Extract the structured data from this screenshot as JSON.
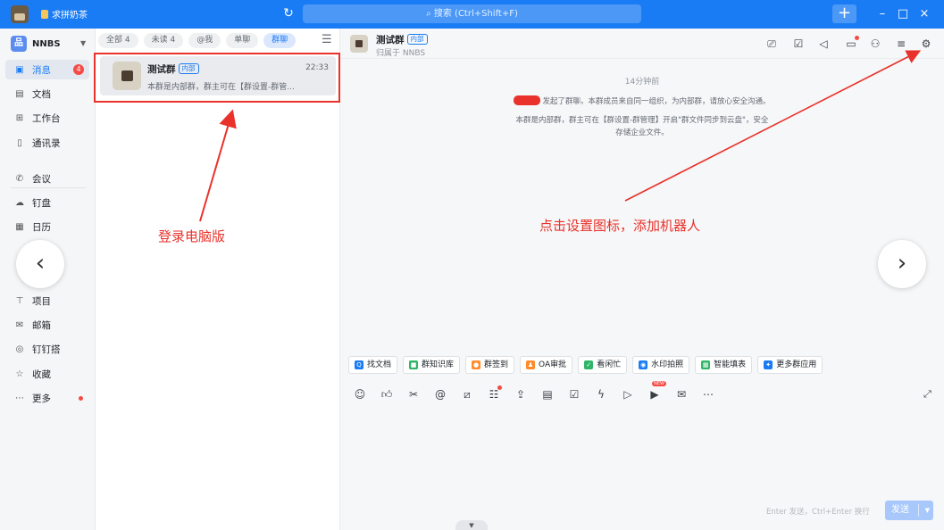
{
  "titlebar": {
    "app_name": "求拼奶茶",
    "search_placeholder": "搜索 (Ctrl+Shift+F)",
    "add_icon": "plus-icon",
    "minimize": "–",
    "maximize": "□",
    "close": "×"
  },
  "sidebar": {
    "org_name": "NNBS",
    "items": [
      {
        "label": "消息",
        "icon": "chat-icon",
        "badge": "4"
      },
      {
        "label": "文档",
        "icon": "doc-icon"
      },
      {
        "label": "工作台",
        "icon": "grid-icon"
      },
      {
        "label": "通讯录",
        "icon": "contacts-icon"
      },
      {
        "label": "会议",
        "icon": "phone-icon"
      },
      {
        "label": "钉盘",
        "icon": "cloud-icon"
      },
      {
        "label": "日历",
        "icon": "calendar-icon"
      },
      {
        "label": "项目",
        "icon": "project-icon"
      },
      {
        "label": "邮箱",
        "icon": "mail-icon"
      },
      {
        "label": "钉钉搭",
        "icon": "build-icon"
      },
      {
        "label": "收藏",
        "icon": "star-icon"
      },
      {
        "label": "更多",
        "icon": "more-icon"
      }
    ]
  },
  "chatlist": {
    "filters": [
      "全部 4",
      "未读 4",
      "@我",
      "单聊",
      "群聊"
    ],
    "active_filter": "群聊",
    "conversation": {
      "name": "测试群",
      "tag": "内部",
      "time": "22:33",
      "preview": "本群是内部群，群主可在【群设置-群管..."
    }
  },
  "chat": {
    "title": "测试群",
    "tag": "内部",
    "subtitle": "归属于 NNBS",
    "sys_time": "14分钟前",
    "sys_line1": "发起了群聊。本群成员来自同一组织，为内部群，请放心安全沟通。",
    "sys_line2": "本群是内部群，群主可在【群设置-群管理】开启\"群文件同步到云盘\"，安全",
    "sys_line3": "存储企业文件。",
    "quick_actions": [
      {
        "label": "找文档",
        "color": "#1a7cf5"
      },
      {
        "label": "群知识库",
        "color": "#2fb566"
      },
      {
        "label": "群签到",
        "color": "#ff8b2c"
      },
      {
        "label": "OA审批",
        "color": "#ff8b2c"
      },
      {
        "label": "看闲忙",
        "color": "#2fb566"
      },
      {
        "label": "水印拍照",
        "color": "#1a7cf5"
      },
      {
        "label": "智能填表",
        "color": "#2fb566"
      },
      {
        "label": "更多群应用",
        "color": "#1a7cf5"
      }
    ],
    "input_hint": "Enter 发送，Ctrl+Enter 换行",
    "send_label": "发送"
  },
  "annotations": {
    "left_note": "登录电脑版",
    "right_note": "点击设置图标，添加机器人"
  }
}
